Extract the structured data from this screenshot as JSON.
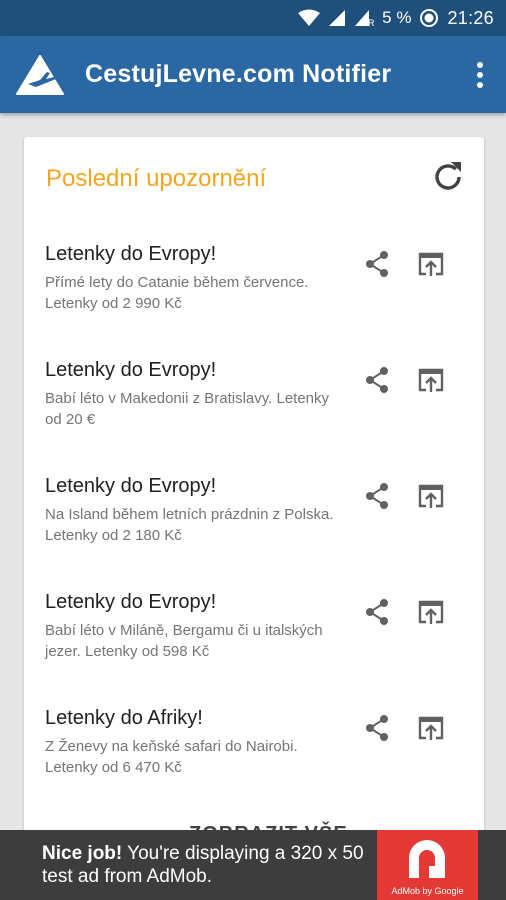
{
  "status_bar": {
    "battery_text": "5 %",
    "time": "21:26",
    "icons": [
      "wifi-icon",
      "signal-icon",
      "signal-r-icon",
      "battery-icon"
    ]
  },
  "app_bar": {
    "title": "CestujLevne.com Notifier",
    "logo_icon": "airplane-logo-icon",
    "menu_icon": "more-vert-icon"
  },
  "card": {
    "title": "Poslední upozornění",
    "refresh_icon": "refresh-icon",
    "accent_color": "#f4a51e"
  },
  "notifications": [
    {
      "title": "Letenky do Evropy!",
      "description": "Přímé lety do Catanie během července. Letenky od 2 990 Kč"
    },
    {
      "title": "Letenky do Evropy!",
      "description": "Babí léto v Makedonii z Bratislavy. Letenky od 20 €"
    },
    {
      "title": "Letenky do Evropy!",
      "description": "Na Island během letních prázdnin z Polska. Letenky od 2 180 Kč"
    },
    {
      "title": "Letenky do Evropy!",
      "description": "Babí léto v Miláně, Bergamu či u italských jezer. Letenky od 598 Kč"
    },
    {
      "title": "Letenky do Afriky!",
      "description": "Z Ženevy na keňské safari do Nairobi. Letenky od 6 470 Kč"
    }
  ],
  "peek_text": "ZOBRAZIT VŠE",
  "ad": {
    "bold": "Nice job!",
    "text": " You're displaying a 320 x 50 test ad from AdMob.",
    "logo_caption": "AdMob by Google"
  },
  "colors": {
    "status_bar": "#1f4f7b",
    "app_bar": "#2b67a2",
    "background": "#e6e6e6",
    "ad_background": "#3d3d3d",
    "ad_logo": "#e53935"
  }
}
